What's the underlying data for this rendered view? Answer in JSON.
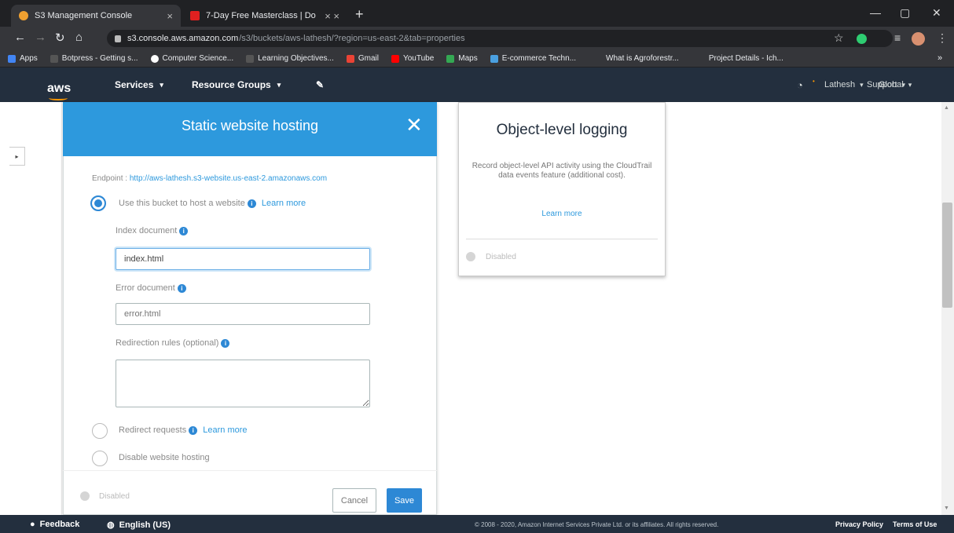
{
  "browser": {
    "tabs": [
      {
        "label": "S3 Management Console",
        "close": "×",
        "favicon_color": "#f0a030"
      },
      {
        "label": "7-Day Free Masterclass | Do",
        "close": "× ×",
        "favicon_color": "#e02020"
      }
    ],
    "new_tab": "+",
    "window_controls": [
      "—",
      "▢",
      "✕"
    ],
    "url_host": "s3.console.aws.amazon.com",
    "url_path": "/s3/buckets/aws-lathesh/?region=us-east-2&tab=properties",
    "bookmarks": [
      {
        "label": "Apps",
        "color": "#4285f4"
      },
      {
        "label": "Botpress - Getting s...",
        "color": "#555"
      },
      {
        "label": "Computer Science...",
        "color": "#ffffff"
      },
      {
        "label": "Learning Objectives...",
        "color": "#555"
      },
      {
        "label": "Gmail",
        "color": "#ea4335"
      },
      {
        "label": "YouTube",
        "color": "#ff0000"
      },
      {
        "label": "Maps",
        "color": "#34a853"
      },
      {
        "label": "E-commerce Techn...",
        "color": "#4aa0e0"
      },
      {
        "label": "What is Agroforestr...",
        "color": "#333"
      },
      {
        "label": "Project Details - Ich...",
        "color": "#333"
      }
    ],
    "more_bookmarks": "»"
  },
  "aws_nav": {
    "logo": "aws",
    "services": "Services",
    "resource_groups": "Resource Groups",
    "pin": "✎",
    "bell": "🔔",
    "user": "Lathesh",
    "region": "Global",
    "support": "Support",
    "caret": "▾"
  },
  "panel": {
    "title": "Static website hosting",
    "close": "✕",
    "endpoint_label": "Endpoint :",
    "endpoint_url": "http://aws-lathesh.s3-website.us-east-2.amazonaws.com",
    "option_host": "Use this bucket to host a website",
    "learn_more": "Learn more",
    "index_label": "Index document",
    "index_value": "index.html",
    "error_label": "Error document",
    "error_placeholder": "error.html",
    "redirection_label": "Redirection rules (optional)",
    "option_redirect": "Redirect requests",
    "option_disable": "Disable website hosting",
    "status": "Disabled",
    "cancel": "Cancel",
    "save": "Save",
    "info": "i"
  },
  "card": {
    "title": "Object-level logging",
    "description": "Record object-level API activity using the CloudTrail data events feature (additional cost).",
    "learn_more": "Learn more",
    "status": "Disabled"
  },
  "footer": {
    "feedback": "Feedback",
    "language": "English (US)",
    "copyright": "© 2008 - 2020, Amazon Internet Services Private Ltd. or its affiliates. All rights reserved.",
    "privacy": "Privacy Policy",
    "terms": "Terms of Use"
  },
  "colors": {
    "aws_nav": "#232f3e",
    "panel_header": "#2d99dd",
    "save_button": "#2d88d5",
    "link": "#2d99dd"
  }
}
